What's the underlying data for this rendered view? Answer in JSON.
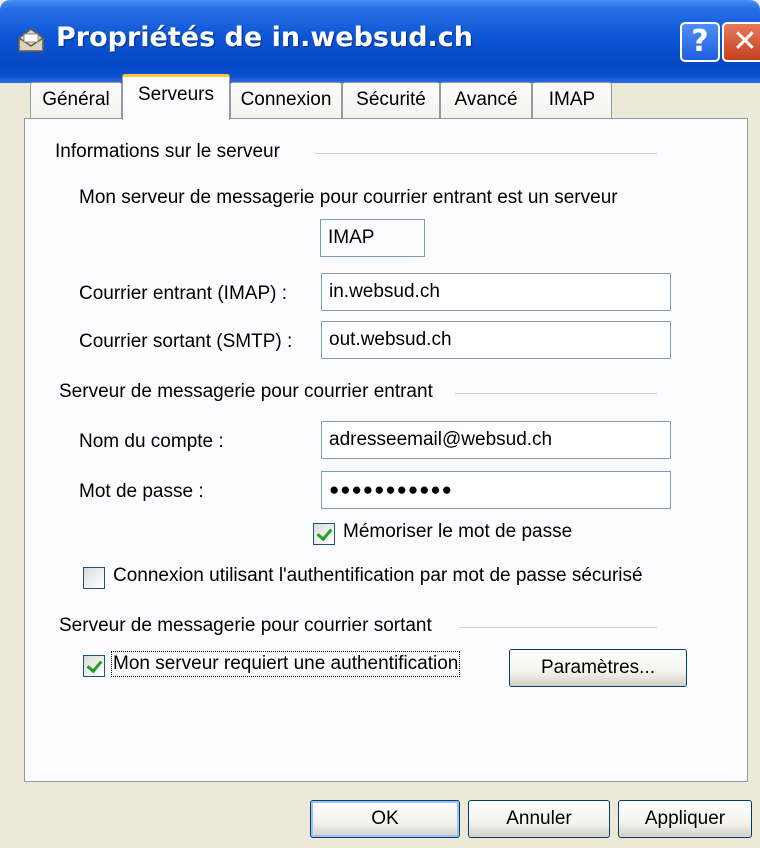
{
  "window": {
    "title": "Propriétés de in.websud.ch"
  },
  "tabs": [
    "Général",
    "Serveurs",
    "Connexion",
    "Sécurité",
    "Avancé",
    "IMAP"
  ],
  "server_info": {
    "group_label": "Informations sur le serveur",
    "incoming_type_label": "Mon serveur de messagerie pour courrier entrant est un serveur",
    "incoming_type_value": "IMAP",
    "incoming_label": "Courrier entrant (IMAP) :",
    "incoming_value": "in.websud.ch",
    "outgoing_label": "Courrier sortant (SMTP) :",
    "outgoing_value": "out.websud.ch"
  },
  "incoming": {
    "group_label": "Serveur de messagerie pour courrier entrant",
    "account_label": "Nom du compte :",
    "account_value": "adresseemail@websud.ch",
    "password_label": "Mot de passe :",
    "password_value": "●●●●●●●●●●●",
    "remember_label": "Mémoriser le mot de passe",
    "remember_checked": true,
    "spa_label": "Connexion utilisant l'authentification par mot de passe sécurisé",
    "spa_checked": false
  },
  "outgoing": {
    "group_label": "Serveur de messagerie pour courrier sortant",
    "auth_label": "Mon serveur requiert une authentification",
    "auth_checked": true,
    "settings_button": "Paramètres..."
  },
  "buttons": {
    "ok": "OK",
    "cancel": "Annuler",
    "apply": "Appliquer"
  },
  "colors": {
    "titlebar": "#0b55d6",
    "dialog_bg": "#ece9d8",
    "tab_highlight": "#ffc83c",
    "close": "#c3401f"
  }
}
